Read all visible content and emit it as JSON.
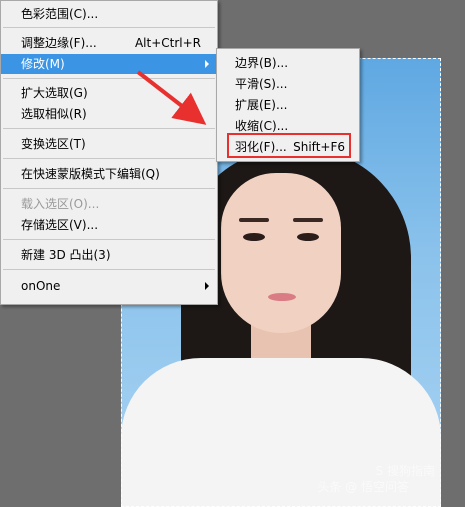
{
  "main_menu": {
    "items": [
      {
        "label": "色彩范围(C)...",
        "shortcut": "",
        "disabled": false
      },
      {
        "label": "调整边缘(F)...",
        "shortcut": "Alt+Ctrl+R",
        "disabled": false
      },
      {
        "label": "修改(M)",
        "shortcut": "",
        "disabled": false,
        "submenu": true,
        "highlighted": true
      },
      {
        "label": "扩大选取(G)",
        "shortcut": "",
        "disabled": false
      },
      {
        "label": "选取相似(R)",
        "shortcut": "",
        "disabled": false
      },
      {
        "label": "变换选区(T)",
        "shortcut": "",
        "disabled": false
      },
      {
        "label": "在快速蒙版模式下编辑(Q)",
        "shortcut": "",
        "disabled": false
      },
      {
        "label": "载入选区(O)...",
        "shortcut": "",
        "disabled": true
      },
      {
        "label": "存储选区(V)...",
        "shortcut": "",
        "disabled": false
      },
      {
        "label": "新建 3D 凸出(3)",
        "shortcut": "",
        "disabled": false
      },
      {
        "label": "onOne",
        "shortcut": "",
        "disabled": false,
        "submenu": true
      }
    ]
  },
  "sub_menu": {
    "items": [
      {
        "label": "边界(B)...",
        "shortcut": ""
      },
      {
        "label": "平滑(S)...",
        "shortcut": ""
      },
      {
        "label": "扩展(E)...",
        "shortcut": ""
      },
      {
        "label": "收缩(C)...",
        "shortcut": ""
      },
      {
        "label": "羽化(F)...",
        "shortcut": "Shift+F6"
      }
    ]
  },
  "watermark": {
    "line1": "S 搜狗指南",
    "line2": "头条 @ 悟空问答"
  },
  "colors": {
    "highlight": "#3c95e4",
    "annotation": "#e8302f",
    "workspace": "#6e6e6e"
  }
}
